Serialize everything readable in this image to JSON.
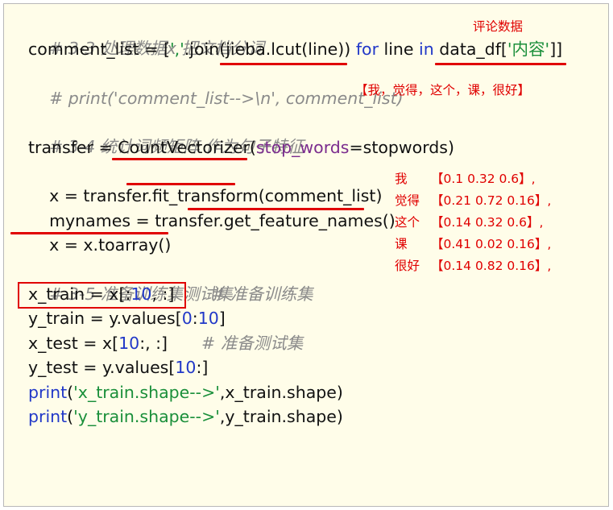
{
  "code": {
    "l1": {
      "comment": "# 3-3 处理数据x 把文档分词"
    },
    "l2": {
      "p1": "comment_list = [",
      "s1": "','",
      "p2": ".join(jieba.lcut(line)) ",
      "kw1": "for",
      "p3": " line ",
      "kw2": "in",
      "p4": " data_df[",
      "s2": "'内容'",
      "p5": "]]"
    },
    "l3": {
      "comment": "# print('comment_list-->\\n', comment_list)"
    },
    "l4": {
      "comment": "# 3-4 统计词频矩阵 作为句子特征"
    },
    "l5": {
      "p1": "transfer = CountVectorizer(",
      "param": "stop_words",
      "p2": "=stopwords)"
    },
    "l6": {
      "text": "x = transfer.fit_transform(comment_list)"
    },
    "l7": {
      "text": "mynames = transfer.get_feature_names()"
    },
    "l8": {
      "text": "x = x.toarray()"
    },
    "l9": {
      "comment": "# 3-5 准备训练集测试集"
    },
    "l10": {
      "p1": "x_train = x[:",
      "n1": "10",
      "p2": ", :]",
      "comment": "# 准备训练集"
    },
    "l11": {
      "p1": "y_train = y.values[",
      "n1": "0",
      "p2": ":",
      "n2": "10",
      "p3": "]"
    },
    "l12": {
      "p1": "x_test = x[",
      "n1": "10",
      "p2": ":, :]",
      "comment": "# 准备测试集"
    },
    "l13": {
      "p1": "y_test = y.values[",
      "n1": "10",
      "p2": ":]"
    },
    "l14": {
      "kw": "print",
      "p1": "(",
      "s1": "'x_train.shape-->'",
      "p2": ",x_train.shape)"
    },
    "l15": {
      "kw": "print",
      "p1": "(",
      "s1": "'y_train.shape-->'",
      "p2": ",y_train.shape)"
    }
  },
  "annotations": {
    "comment_data": "评论数据",
    "tokens": "【我，觉得，这个，课，很好】",
    "matrix": [
      {
        "word": "我",
        "vec": "【0.1 0.32 0.6】,"
      },
      {
        "word": "觉得",
        "vec": "【0.21 0.72 0.16】,"
      },
      {
        "word": "这个",
        "vec": "【0.14 0.32 0.6】,"
      },
      {
        "word": "课",
        "vec": "【0.41 0.02 0.16】,"
      },
      {
        "word": "很好",
        "vec": "【0.14 0.82 0.16】,"
      }
    ]
  },
  "colors": {
    "background": "#fffde9",
    "annotation": "#e00000",
    "keyword": "#2138c8",
    "string": "#1a8f3a",
    "parameter": "#7b2c8e",
    "comment": "#8a8a8a"
  }
}
